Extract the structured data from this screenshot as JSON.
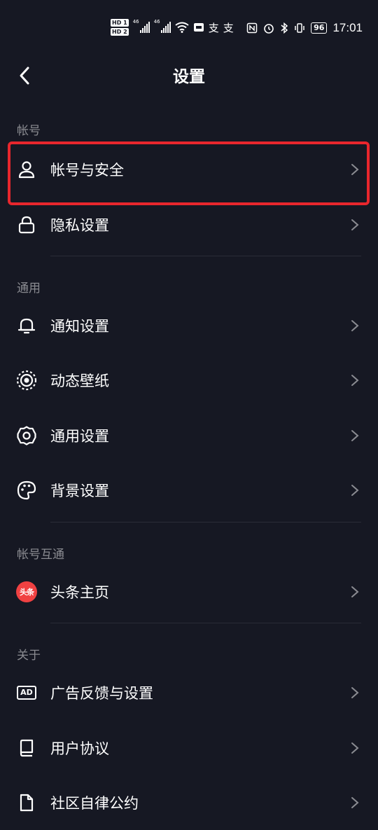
{
  "status_bar": {
    "hd1": "HD 1",
    "hd2": "HD 2",
    "net1": "46",
    "net2": "46",
    "battery": "96",
    "time": "17:01"
  },
  "nav": {
    "title": "设置"
  },
  "sections": [
    {
      "title": "帐号",
      "items": [
        {
          "label": "帐号与安全",
          "icon": "person-icon"
        },
        {
          "label": "隐私设置",
          "icon": "lock-icon"
        }
      ]
    },
    {
      "title": "通用",
      "items": [
        {
          "label": "通知设置",
          "icon": "bell-icon"
        },
        {
          "label": "动态壁纸",
          "icon": "live-wallpaper-icon"
        },
        {
          "label": "通用设置",
          "icon": "gear-icon"
        },
        {
          "label": "背景设置",
          "icon": "palette-icon"
        }
      ]
    },
    {
      "title": "帐号互通",
      "items": [
        {
          "label": "头条主页",
          "icon": "toutiao-icon",
          "badge_text": "头条"
        }
      ]
    },
    {
      "title": "关于",
      "items": [
        {
          "label": "广告反馈与设置",
          "icon": "ad-icon",
          "badge_text": "AD"
        },
        {
          "label": "用户协议",
          "icon": "book-icon"
        },
        {
          "label": "社区自律公约",
          "icon": "document-icon"
        }
      ]
    }
  ],
  "colors": {
    "background": "#161823",
    "highlight": "#e8262d",
    "muted": "#8a8b91"
  }
}
